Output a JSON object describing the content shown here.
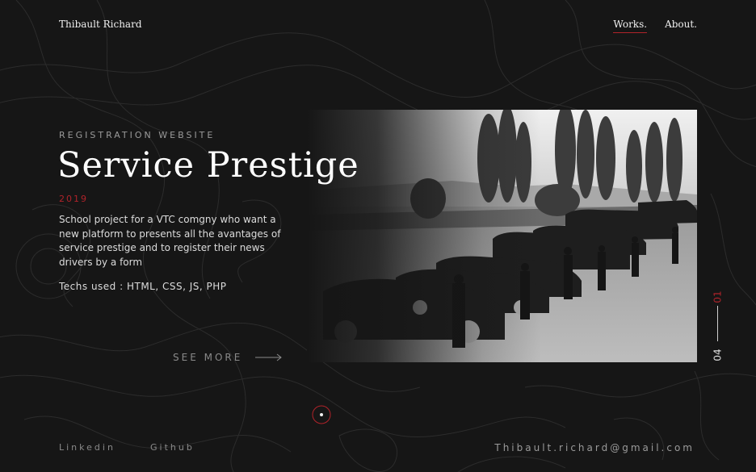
{
  "header": {
    "brand": "Thibault Richard",
    "nav": [
      {
        "label": "Works."
      },
      {
        "label": "About."
      }
    ]
  },
  "project": {
    "category": "REGISTRATION WEBSITE",
    "title": "Service Prestige",
    "year": "2019",
    "description": "School project for a VTC comgny who want a new platform to presents all the avantages of service prestige and to register their news drivers by a form",
    "techs": "Techs used : HTML, CSS, JS, PHP",
    "see_more": "SEE MORE"
  },
  "counter": {
    "current": "01",
    "total": "04"
  },
  "footer": {
    "linkedin": "Linkedin",
    "github": "Github",
    "email": "Thibault.richard@gmail.com"
  },
  "colors": {
    "accent": "#b0232a",
    "background": "#161616"
  },
  "icons": {
    "arrow": "arrow-right-icon",
    "scroll": "scroll-indicator-icon"
  }
}
